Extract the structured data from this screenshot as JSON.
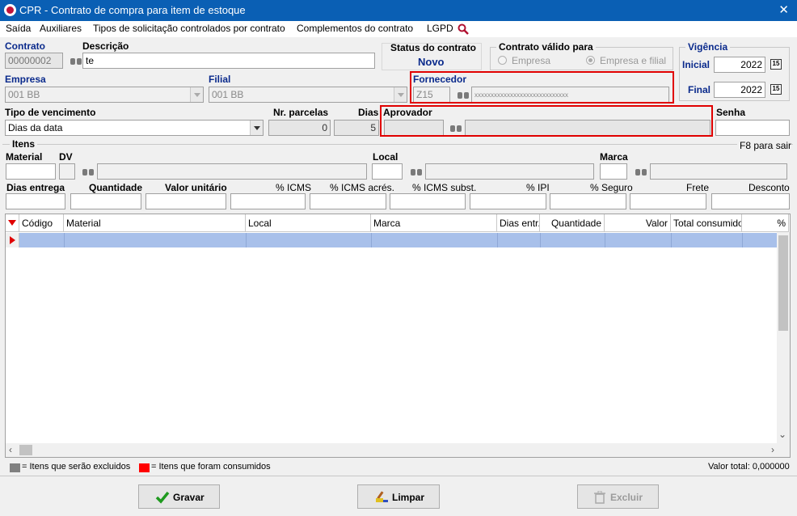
{
  "window": {
    "title": "CPR - Contrato de compra para item de estoque",
    "close": "✕"
  },
  "menu": {
    "items": [
      "Saída",
      "Auxiliares",
      "Tipos de solicitação controlados por contrato",
      "Complementos do contrato",
      "LGPD"
    ]
  },
  "contrato": {
    "label": "Contrato",
    "value": "00000002"
  },
  "descricao": {
    "label": "Descrição",
    "value": "te"
  },
  "status": {
    "label": "Status do contrato",
    "value": "Novo"
  },
  "valido": {
    "label": "Contrato válido para",
    "opt1": "Empresa",
    "opt2": "Empresa e filial",
    "selected": "Empresa e filial"
  },
  "vigencia": {
    "label": "Vigência",
    "inicial_label": "Inicial",
    "inicial_value": "2022",
    "final_label": "Final",
    "final_value": "2022",
    "cal": "15"
  },
  "empresa": {
    "label": "Empresa",
    "value": "001 BB"
  },
  "filial": {
    "label": "Filial",
    "value": "001 BB"
  },
  "fornecedor": {
    "label": "Fornecedor",
    "code": "Z15",
    "name": "xxxxxxxxxxxxxxxxxxxxxxxxxxxxx"
  },
  "vencimento": {
    "label": "Tipo de vencimento",
    "value": "Dias da data"
  },
  "parcelas": {
    "label": "Nr. parcelas",
    "value": "0"
  },
  "dias": {
    "label": "Dias",
    "value": "5"
  },
  "aprovador": {
    "label": "Aprovador"
  },
  "senha": {
    "label": "Senha"
  },
  "itens": {
    "title": "Itens",
    "hint": "F8 para sair",
    "material": "Material",
    "dv": "DV",
    "local": "Local",
    "marca": "Marca",
    "dias_entrega": "Dias entrega",
    "quantidade": "Quantidade",
    "valor_unitario": "Valor unitário",
    "icms": "% ICMS",
    "icms_acres": "% ICMS acrés.",
    "icms_subst": "% ICMS subst.",
    "ipi": "% IPI",
    "seguro": "% Seguro",
    "frete": "Frete",
    "desconto": "Desconto"
  },
  "grid": {
    "columns": [
      "Código",
      "Material",
      "Local",
      "Marca",
      "Dias entr.",
      "Quantidade",
      "Valor",
      "Total consumido",
      "%"
    ],
    "rows": [
      [
        "",
        "",
        "",
        "",
        "",
        "",
        "",
        "",
        ""
      ]
    ]
  },
  "legend": {
    "excluded": "= Itens que serão excluidos",
    "consumed": "= Itens que foram consumidos",
    "excluded_color": "#808080",
    "consumed_color": "#ff0000",
    "total": "Valor total: 0,000000"
  },
  "buttons": {
    "gravar": "Gravar",
    "limpar": "Limpar",
    "excluir": "Excluir"
  }
}
